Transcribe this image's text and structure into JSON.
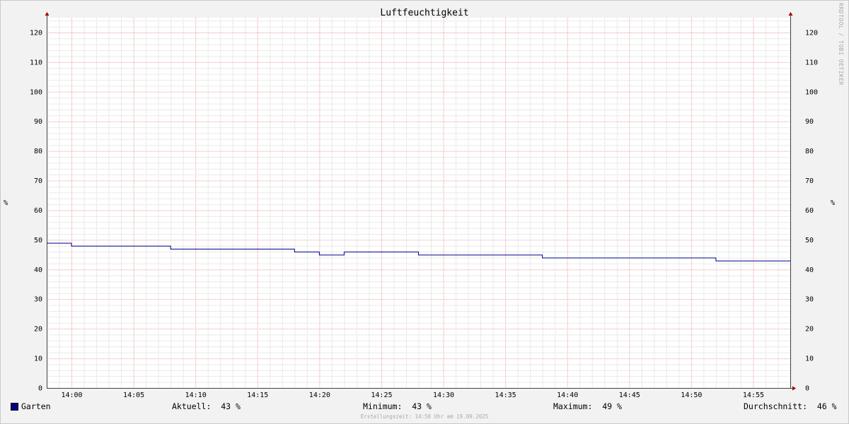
{
  "window": {
    "watermark": "RRDTOOL / TOBI OETIKER"
  },
  "chart_data": {
    "type": "line",
    "title": "Luftfeuchtigkeit",
    "ylabel": "%",
    "ylim": [
      0,
      125
    ],
    "yticks": [
      0,
      10,
      20,
      30,
      40,
      50,
      60,
      70,
      80,
      90,
      100,
      110,
      120
    ],
    "xlabel": "",
    "xlim_minutes": [
      -2,
      58
    ],
    "xticks": [
      {
        "minute": 0,
        "label": "14:00"
      },
      {
        "minute": 5,
        "label": "14:05"
      },
      {
        "minute": 10,
        "label": "14:10"
      },
      {
        "minute": 15,
        "label": "14:15"
      },
      {
        "minute": 20,
        "label": "14:20"
      },
      {
        "minute": 25,
        "label": "14:25"
      },
      {
        "minute": 30,
        "label": "14:30"
      },
      {
        "minute": 35,
        "label": "14:35"
      },
      {
        "minute": 40,
        "label": "14:40"
      },
      {
        "minute": 45,
        "label": "14:45"
      },
      {
        "minute": 50,
        "label": "14:50"
      },
      {
        "minute": 55,
        "label": "14:55"
      }
    ],
    "grid": true,
    "series": [
      {
        "name": "Garten",
        "color": "#00008b",
        "step": true,
        "x": [
          -2,
          0,
          8,
          18,
          20,
          22,
          28,
          38,
          52,
          58
        ],
        "y": [
          49,
          48,
          47,
          46,
          45,
          46,
          45,
          44,
          43,
          43
        ]
      }
    ]
  },
  "legend": {
    "series_name": "Garten",
    "current": "Aktuell:  43 %",
    "minimum": "Minimum:  43 %",
    "maximum": "Maximum:  49 %",
    "average": "Durchschnitt:  46 %"
  },
  "footer": "Erstellungszeit: 14:58 Uhr am 19.09.2025"
}
